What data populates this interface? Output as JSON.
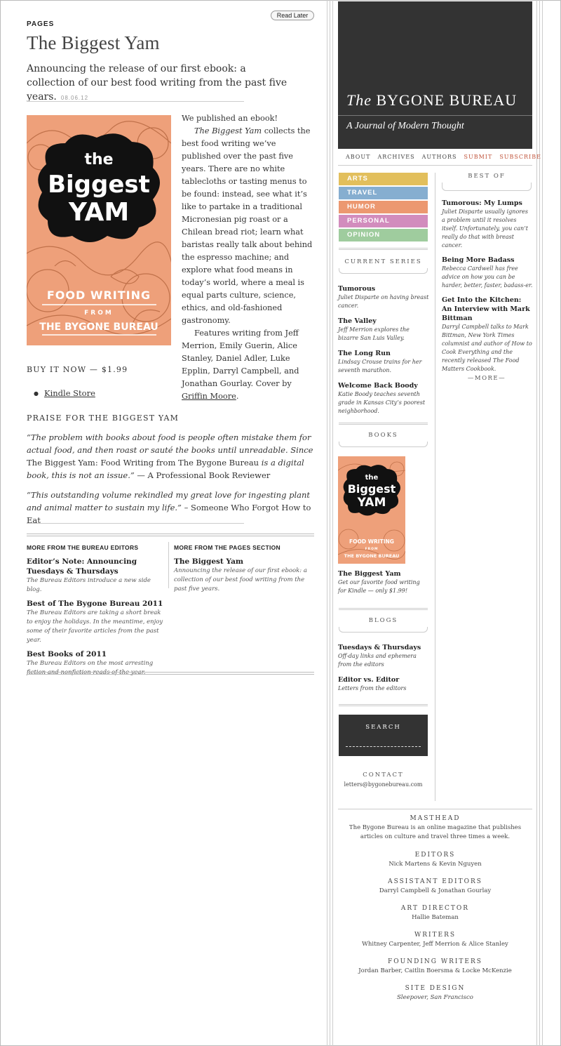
{
  "page": {
    "section": "PAGES",
    "read_later": "Read Later",
    "title": "The Biggest Yam",
    "dek": "Announcing the release of our first ebook: a collection of our best food writing from the past five years.",
    "date": "08.06.12",
    "body": {
      "p1": "We published an ebook!",
      "p2_em": "The Biggest Yam",
      "p2_rest": " collects the best food writing we’ve published over the past five years. There are no white tablecloths or tasting menus to be found: instead, see what it’s like to partake in a traditional Micronesian pig roast or a Chilean bread riot; learn what baristas really talk about behind the espresso machine; and explore what food means in today’s world, where a meal is equal parts culture, science, ethics, and old-fashioned gastronomy.",
      "p3": "Features writing from Jeff Merrion, Emily Guerin, Alice Stanley, Daniel Adler, Luke Epplin, Darryl Campbell, and Jonathan Gourlay. Cover by ",
      "p3_link": "Griffin Moore",
      "p3_end": "."
    },
    "cover": {
      "line1": "the",
      "line2": "Biggest",
      "line3": "YAM",
      "line4": "FOOD WRITING",
      "line5": "FROM",
      "line6": "THE BYGONE BUREAU"
    },
    "buy_heading": "BUY IT NOW — $1.99",
    "buy_links": [
      "Kindle Store"
    ],
    "praise_heading": "PRAISE FOR THE BIGGEST YAM",
    "praise": [
      {
        "q1": "“The problem with books about food is people often mistake them for actual food, and then roast or sauté the books until unreadable. Since ",
        "q_plain": "The Biggest Yam: Food Writing from The Bygone Bureau",
        "q2": " is a digital book, this is not an issue.”",
        "attrib": " — A Professional Book Reviewer"
      },
      {
        "q1": "“This outstanding volume rekindled my great love for ingesting plant and animal matter to sustain my life.”",
        "attrib": " – Someone Who Forgot How to Eat"
      }
    ],
    "more_editors": {
      "heading": "MORE FROM THE BUREAU EDITORS",
      "items": [
        {
          "title": "Editor’s Note: Announcing Tuesdays & Thursdays",
          "desc": "The Bureau Editors introduce a new side blog."
        },
        {
          "title": "Best of The Bygone Bureau 2011",
          "desc": "The Bureau Editors are taking a short break to enjoy the holidays. In the meantime, enjoy some of their favorite articles from the past year."
        },
        {
          "title": "Best Books of 2011",
          "desc": "The Bureau Editors on the most arresting fiction and nonfiction reads of the year."
        }
      ]
    },
    "more_pages": {
      "heading": "MORE FROM THE PAGES SECTION",
      "items": [
        {
          "title": "The Biggest Yam",
          "desc": "Announcing the release of our first ebook: a collection of our best food writing from the past five years."
        }
      ]
    }
  },
  "sidebar": {
    "logo_the": "The",
    "logo_name": "BYGONE BUREAU",
    "tagline": "A Journal of Modern Thought",
    "nav": [
      "ABOUT",
      "ARCHIVES",
      "AUTHORS",
      "SUBMIT",
      "SUBSCRIBE"
    ],
    "categories": [
      {
        "label": "ARTS",
        "color": "#e2bf5c"
      },
      {
        "label": "TRAVEL",
        "color": "#86aed0"
      },
      {
        "label": "HUMOR",
        "color": "#ec9870"
      },
      {
        "label": "PERSONAL",
        "color": "#d28cbd"
      },
      {
        "label": "OPINION",
        "color": "#9fcc9e"
      }
    ],
    "current_series": {
      "heading": "CURRENT SERIES",
      "items": [
        {
          "title": "Tumorous",
          "desc": "Juliet Disparte on having breast cancer."
        },
        {
          "title": "The Valley",
          "desc": "Jeff Merrion explores the bizarre San Luis Valley."
        },
        {
          "title": "The Long Run",
          "desc": "Lindsay Crouse trains for her seventh marathon."
        },
        {
          "title": "Welcome Back Boody",
          "desc": "Katie Boody teaches seventh grade in Kansas City’s poorest neighborhood."
        }
      ]
    },
    "books": {
      "heading": "BOOKS",
      "title": "The Biggest Yam",
      "desc": "Get our favorite food writing for Kindle — only $1.99!"
    },
    "blogs": {
      "heading": "BLOGS",
      "items": [
        {
          "title": "Tuesdays & Thursdays",
          "desc": "Off-day links and ephemera from the editors"
        },
        {
          "title": "Editor vs. Editor",
          "desc": "Letters from the editors"
        }
      ]
    },
    "search": {
      "label": "SEARCH",
      "placeholder": ""
    },
    "contact": {
      "heading": "CONTACT",
      "email": "letters@bygonebureau.com"
    },
    "best_of": {
      "heading": "BEST OF",
      "items": [
        {
          "title": "Tumorous: My Lumps",
          "desc": "Juliet Disparte usually ignores a problem until it resolves itself. Unfortunately, you can’t really do that with breast cancer."
        },
        {
          "title": "Being More Badass",
          "desc": "Rebecca Cardwell has free advice on how you can be harder, better, faster, badass-er."
        },
        {
          "title": "Get Into the Kitchen: An Interview with Mark Bittman",
          "desc": "Darryl Campbell talks to Mark Bittman, New York Times columnist and author of How to Cook Everything and the recently released The Food Matters Cookbook."
        }
      ],
      "more": "—MORE—"
    },
    "masthead": [
      {
        "heading": "MASTHEAD",
        "value": "The Bygone Bureau is an online magazine that publishes articles on culture and travel three times a week."
      },
      {
        "heading": "EDITORS",
        "value": "Nick Martens & Kevin Nguyen"
      },
      {
        "heading": "ASSISTANT EDITORS",
        "value": "Darryl Campbell & Jonathan Gourlay"
      },
      {
        "heading": "ART DIRECTOR",
        "value": "Hallie Bateman"
      },
      {
        "heading": "WRITERS",
        "value": "Whitney Carpenter, Jeff Merrion & Alice Stanley"
      },
      {
        "heading": "FOUNDING WRITERS",
        "value": "Jordan Barber, Caitlin Boersma & Locke McKenzie"
      },
      {
        "heading": "SITE DESIGN",
        "value": "Sleepover, San Francisco"
      }
    ]
  }
}
